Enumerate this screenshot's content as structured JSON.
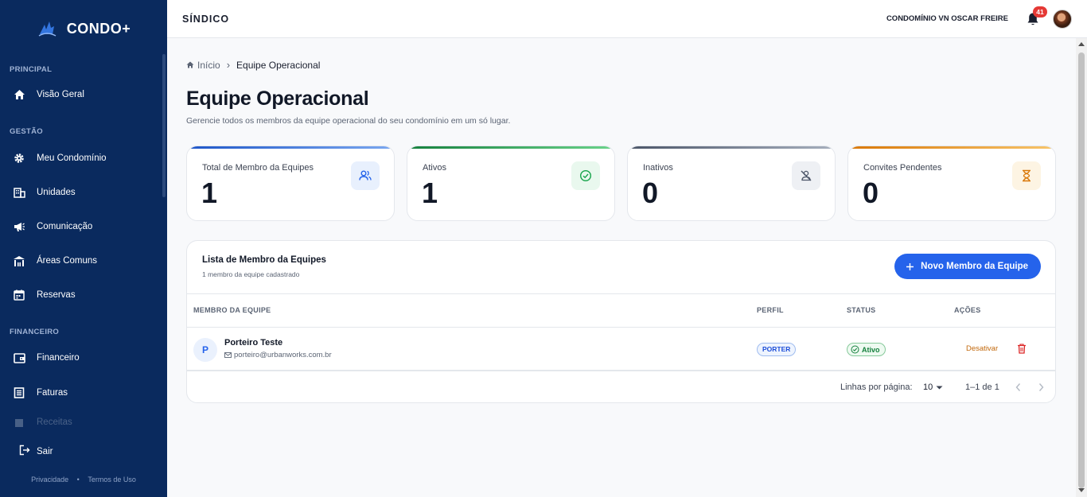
{
  "brand": {
    "name": "CONDO+"
  },
  "sidebar": {
    "sections": [
      {
        "title": "PRINCIPAL"
      },
      {
        "title": "GESTÃO"
      },
      {
        "title": "FINANCEIRO"
      }
    ],
    "items": [
      {
        "label": "Visão Geral",
        "icon": "home-icon"
      },
      {
        "label": "Meu Condomínio",
        "icon": "gear-icon"
      },
      {
        "label": "Unidades",
        "icon": "building-icon"
      },
      {
        "label": "Comunicação",
        "icon": "megaphone-icon"
      },
      {
        "label": "Áreas Comuns",
        "icon": "common-area-icon"
      },
      {
        "label": "Reservas",
        "icon": "calendar-icon"
      },
      {
        "label": "Financeiro",
        "icon": "wallet-icon"
      },
      {
        "label": "Faturas",
        "icon": "invoice-icon"
      },
      {
        "label": "Receitas",
        "icon": "receipt-icon"
      }
    ],
    "logout_label": "Sair",
    "footer": {
      "privacy": "Privacidade",
      "separator": "•",
      "terms": "Termos de Uso"
    }
  },
  "header": {
    "role": "SÍNDICO",
    "condo_name": "CONDOMÍNIO VN OSCAR FREIRE",
    "notification_count": "41"
  },
  "breadcrumb": {
    "home": "Início",
    "separator": "›",
    "current": "Equipe Operacional"
  },
  "page": {
    "title": "Equipe Operacional",
    "subtitle": "Gerencie todos os membros da equipe operacional do seu condomínio em um só lugar."
  },
  "stats": [
    {
      "label": "Total de Membro da Equipes",
      "value": "1",
      "accent": "#3b82f6",
      "icon": "users-icon"
    },
    {
      "label": "Ativos",
      "value": "1",
      "accent": "#16a34a",
      "icon": "check-circle-icon"
    },
    {
      "label": "Inativos",
      "value": "0",
      "accent": "#64748b",
      "icon": "user-off-icon"
    },
    {
      "label": "Convites Pendentes",
      "value": "0",
      "accent": "#f59e0b",
      "icon": "hourglass-icon"
    }
  ],
  "list": {
    "title": "Lista de Membro da Equipes",
    "subtitle": "1 membro da equipe cadastrado",
    "new_button": "Novo Membro da Equipe",
    "columns": [
      "MEMBRO DA EQUIPE",
      "PERFIL",
      "STATUS",
      "AÇÕES"
    ],
    "rows": [
      {
        "initial": "P",
        "name": "Porteiro Teste",
        "email": "porteiro@urbanworks.com.br",
        "perfil": "PORTER",
        "status": "Ativo",
        "action": "Desativar"
      }
    ],
    "pagination": {
      "rows_label": "Linhas por página:",
      "rows_value": "10",
      "range": "1–1 de 1"
    }
  },
  "colors": {
    "sidebar_bg": "#0a2a5e",
    "primary": "#2563eb",
    "danger": "#e53935",
    "warning": "#c2680c"
  }
}
